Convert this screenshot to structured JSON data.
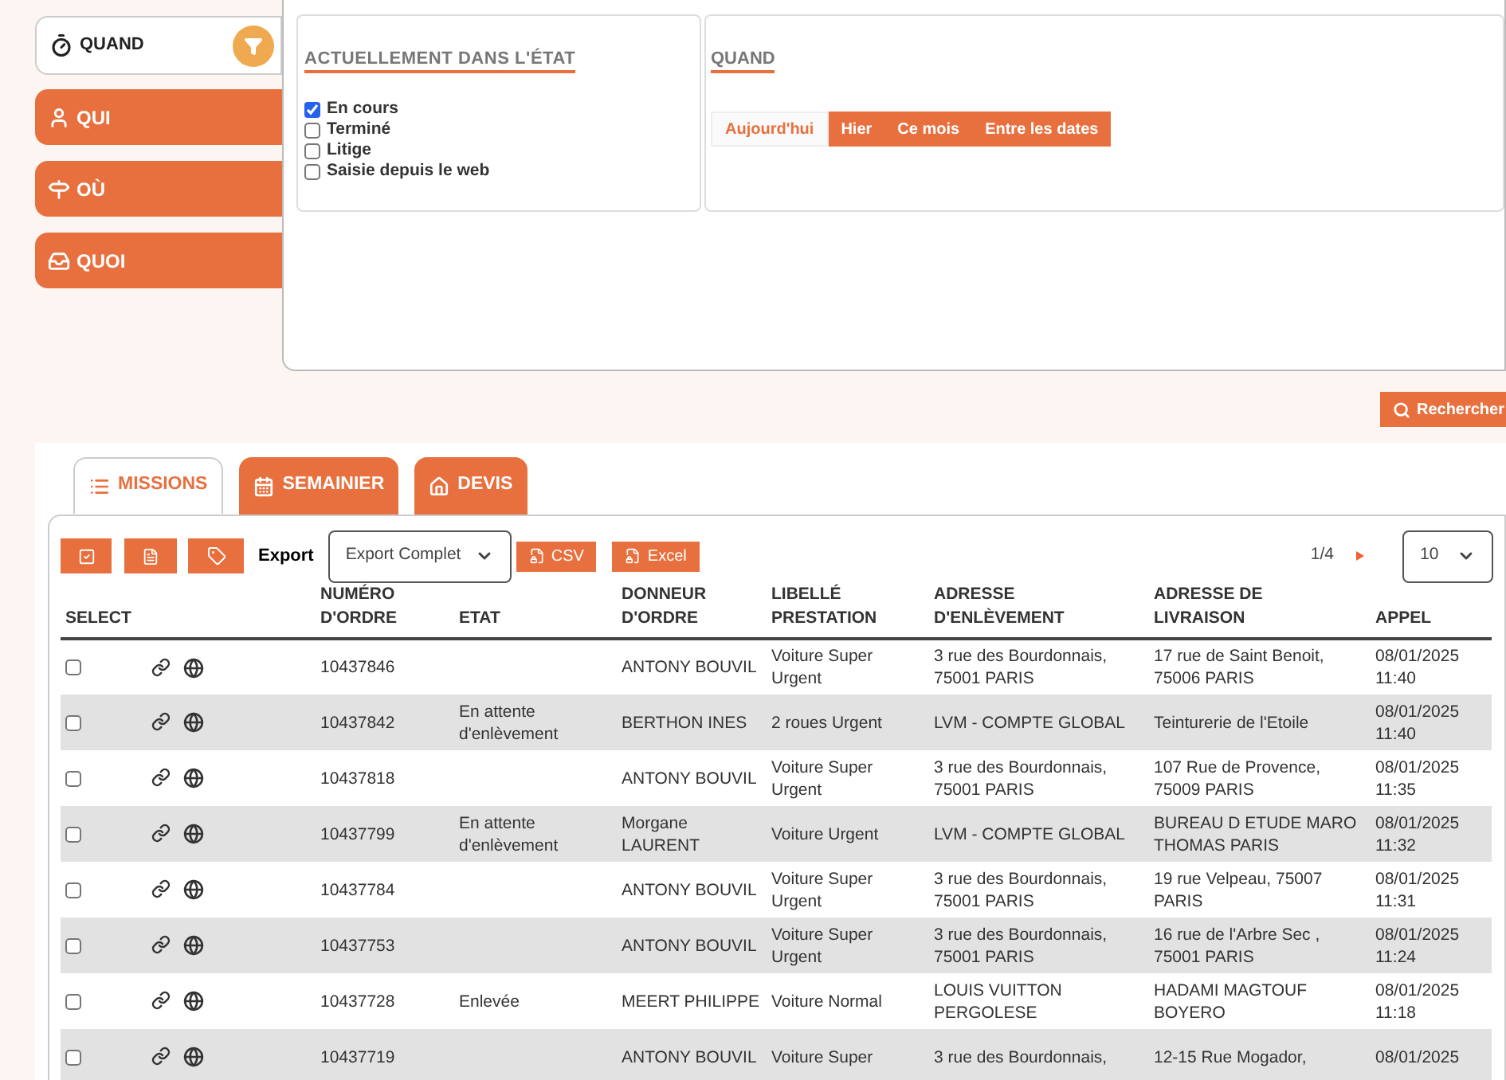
{
  "sidebar": {
    "items": [
      {
        "label": "QUAND",
        "kind": "active",
        "selected": true
      },
      {
        "label": "QUI",
        "kind": "person",
        "selected": false
      },
      {
        "label": "OÙ",
        "kind": "sign",
        "selected": false
      },
      {
        "label": "QUOI",
        "kind": "box",
        "selected": false
      }
    ]
  },
  "state_panel": {
    "title": "ACTUELLEMENT DANS L'ÉTAT",
    "options": [
      {
        "label": "En cours",
        "checked": true
      },
      {
        "label": "Terminé",
        "checked": false
      },
      {
        "label": "Litige",
        "checked": false
      },
      {
        "label": "Saisie depuis le web",
        "checked": false
      }
    ]
  },
  "when_panel": {
    "title": "QUAND",
    "tabs": [
      {
        "label": "Aujourd'hui",
        "selected": true
      },
      {
        "label": "Hier",
        "selected": false
      },
      {
        "label": "Ce mois",
        "selected": false
      },
      {
        "label": "Entre les dates",
        "selected": false
      }
    ]
  },
  "search_button": "Rechercher",
  "tabs": [
    {
      "label": "MISSIONS",
      "kind": "list",
      "selected": true
    },
    {
      "label": "SEMAINIER",
      "kind": "calendar",
      "selected": false
    },
    {
      "label": "DEVIS",
      "kind": "home",
      "selected": false
    }
  ],
  "toolbar": {
    "export_label": "Export",
    "export_value": "Export Complet",
    "buttons": [
      "CSV",
      "Excel"
    ],
    "pagination": "1/4",
    "page_size": "10"
  },
  "table": {
    "columns": [
      "SELECT",
      "",
      "NUMÉRO D'ORDRE",
      "ETAT",
      "DONNEUR D'ORDRE",
      "LIBELLÉ PRESTATION",
      "ADRESSE D'ENLÈVEMENT",
      "ADRESSE DE LIVRAISON",
      "APPEL"
    ],
    "rows": [
      {
        "selected": false,
        "cells": [
          "",
          "",
          "10437846",
          "",
          "ANTONY BOUVIL",
          "Voiture Super Urgent",
          "3 rue des Bourdonnais, 75001 PARIS",
          "17 rue de Saint Benoit, 75006 PARIS",
          "08/01/2025 11:40"
        ]
      },
      {
        "selected": false,
        "cells": [
          "",
          "",
          "10437842",
          "En attente d'enlèvement",
          "BERTHON INES",
          "2 roues Urgent",
          "LVM - COMPTE GLOBAL",
          "Teinturerie de l'Etoile",
          "08/01/2025 11:40"
        ]
      },
      {
        "selected": false,
        "cells": [
          "",
          "",
          "10437818",
          "",
          "ANTONY BOUVIL",
          "Voiture Super Urgent",
          "3 rue des Bourdonnais, 75001 PARIS",
          "107 Rue de Provence, 75009 PARIS",
          "08/01/2025 11:35"
        ]
      },
      {
        "selected": false,
        "cells": [
          "",
          "",
          "10437799",
          "En attente d'enlèvement",
          "Morgane LAURENT",
          "Voiture Urgent",
          "LVM - COMPTE GLOBAL",
          "BUREAU D ETUDE MARO THOMAS PARIS",
          "08/01/2025 11:32"
        ]
      },
      {
        "selected": false,
        "cells": [
          "",
          "",
          "10437784",
          "",
          "ANTONY BOUVIL",
          "Voiture Super Urgent",
          "3 rue des Bourdonnais, 75001 PARIS",
          "19 rue Velpeau, 75007 PARIS",
          "08/01/2025 11:31"
        ]
      },
      {
        "selected": false,
        "cells": [
          "",
          "",
          "10437753",
          "",
          "ANTONY BOUVIL",
          "Voiture Super Urgent",
          "3 rue des Bourdonnais, 75001 PARIS",
          "16 rue de l'Arbre Sec , 75001 PARIS",
          "08/01/2025 11:24"
        ]
      },
      {
        "selected": false,
        "cells": [
          "",
          "",
          "10437728",
          "Enlevée",
          "MEERT PHILIPPE",
          "Voiture Normal",
          "LOUIS VUITTON PERGOLESE",
          "HADAMI MAGTOUF BOYERO",
          "08/01/2025 11:18"
        ]
      },
      {
        "selected": false,
        "cells": [
          "",
          "",
          "10437719",
          "",
          "ANTONY BOUVIL",
          "Voiture Super",
          "3 rue des Bourdonnais,",
          "12-15 Rue Mogador,",
          "08/01/2025"
        ]
      }
    ]
  }
}
